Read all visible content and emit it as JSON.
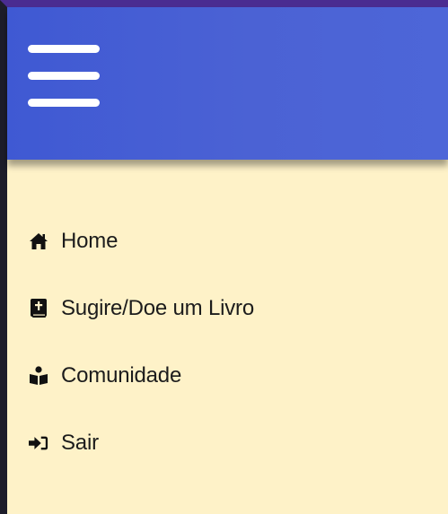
{
  "header": {
    "menu_icon": "hamburger-menu-icon",
    "background_color": "#4a62d6"
  },
  "menu": {
    "items": [
      {
        "label": "Home",
        "icon": "home-icon"
      },
      {
        "label": "Sugire/Doe um Livro",
        "icon": "book-icon"
      },
      {
        "label": "Comunidade",
        "icon": "reading-person-icon"
      },
      {
        "label": "Sair",
        "icon": "sign-in-icon"
      }
    ]
  },
  "colors": {
    "page_background": "#fef2c8",
    "text": "#1c1c1c"
  }
}
